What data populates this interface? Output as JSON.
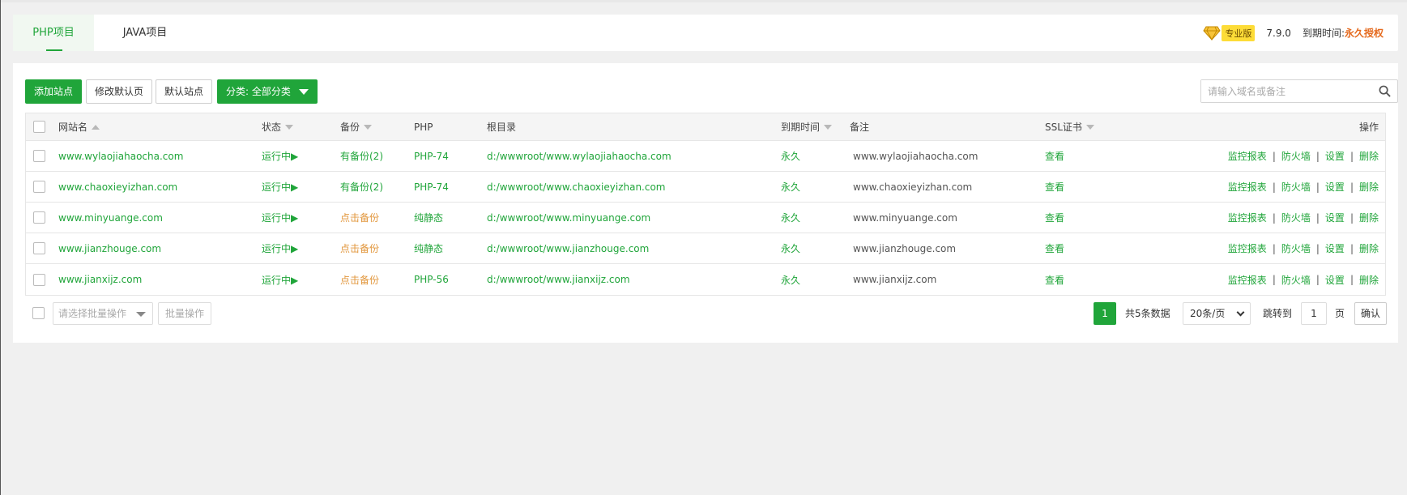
{
  "tabs": {
    "php": "PHP项目",
    "java": "JAVA项目"
  },
  "pro": {
    "badge": "专业版",
    "version": "7.9.0",
    "expire_label": "到期时间:",
    "expire_value": "永久授权"
  },
  "toolbar": {
    "add_site": "添加站点",
    "modify_default_page": "修改默认页",
    "default_site": "默认站点",
    "category": "分类: 全部分类",
    "search_placeholder": "请输入域名或备注"
  },
  "table": {
    "headers": {
      "site": "网站名",
      "status": "状态",
      "backup": "备份",
      "php": "PHP",
      "root": "根目录",
      "expire": "到期时间",
      "remark": "备注",
      "ssl": "SSL证书",
      "ops": "操作"
    },
    "ops": {
      "monitor": "监控报表",
      "firewall": "防火墙",
      "settings": "设置",
      "delete": "删除",
      "sep": "|"
    },
    "rows": [
      {
        "site": "www.wylaojiahaocha.com",
        "status": "运行中▶",
        "backup": "有备份(2)",
        "php": "PHP-74",
        "root": "d:/wwwroot/www.wylaojiahaocha.com",
        "expire": "永久",
        "remark": "www.wylaojiahaocha.com",
        "ssl": "查看"
      },
      {
        "site": "www.chaoxieyizhan.com",
        "status": "运行中▶",
        "backup": "有备份(2)",
        "php": "PHP-74",
        "root": "d:/wwwroot/www.chaoxieyizhan.com",
        "expire": "永久",
        "remark": "www.chaoxieyizhan.com",
        "ssl": "查看"
      },
      {
        "site": "www.minyuange.com",
        "status": "运行中▶",
        "backup": "点击备份",
        "php": "纯静态",
        "root": "d:/wwwroot/www.minyuange.com",
        "expire": "永久",
        "remark": "www.minyuange.com",
        "ssl": "查看"
      },
      {
        "site": "www.jianzhouge.com",
        "status": "运行中▶",
        "backup": "点击备份",
        "php": "纯静态",
        "root": "d:/wwwroot/www.jianzhouge.com",
        "expire": "永久",
        "remark": "www.jianzhouge.com",
        "ssl": "查看"
      },
      {
        "site": "www.jianxijz.com",
        "status": "运行中▶",
        "backup": "点击备份",
        "php": "PHP-56",
        "root": "d:/wwwroot/www.jianxijz.com",
        "expire": "永久",
        "remark": "www.jianxijz.com",
        "ssl": "查看"
      }
    ]
  },
  "footer": {
    "batch_placeholder": "请选择批量操作",
    "batch_button": "批量操作",
    "current_page": "1",
    "total": "共5条数据",
    "per_page": "20条/页",
    "jump_label": "跳转到",
    "jump_value": "1",
    "page_label": "页",
    "confirm": "确认"
  },
  "colors": {
    "accent": "#20a53a",
    "backup_pending": "#e2973d",
    "expire_highlight": "#e56a1e"
  }
}
